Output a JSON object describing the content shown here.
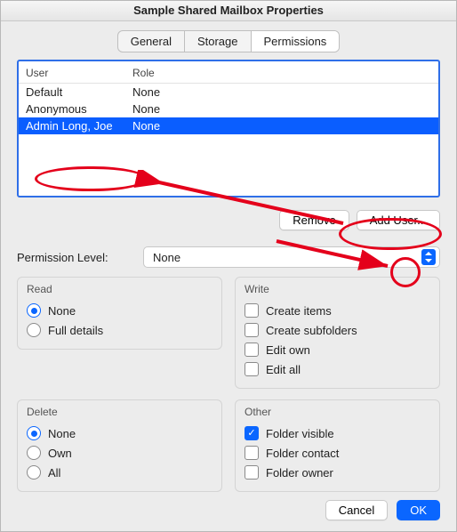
{
  "title": "Sample Shared Mailbox Properties",
  "tabs": {
    "general": "General",
    "storage": "Storage",
    "permissions": "Permissions"
  },
  "table": {
    "head_user": "User",
    "head_role": "Role",
    "rows": [
      {
        "user": "Default",
        "role": "None"
      },
      {
        "user": "Anonymous",
        "role": "None"
      },
      {
        "user": "Admin Long, Joe",
        "role": "None"
      }
    ]
  },
  "buttons": {
    "remove": "Remove",
    "add_user": "Add User..."
  },
  "perm": {
    "label": "Permission Level:",
    "value": "None"
  },
  "groups": {
    "read": {
      "title": "Read",
      "none": "None",
      "full": "Full details"
    },
    "write": {
      "title": "Write",
      "create_items": "Create items",
      "create_sub": "Create subfolders",
      "edit_own": "Edit own",
      "edit_all": "Edit all"
    },
    "delete": {
      "title": "Delete",
      "none": "None",
      "own": "Own",
      "all": "All"
    },
    "other": {
      "title": "Other",
      "folder_visible": "Folder visible",
      "folder_contact": "Folder contact",
      "folder_owner": "Folder owner"
    }
  },
  "footer": {
    "cancel": "Cancel",
    "ok": "OK"
  }
}
